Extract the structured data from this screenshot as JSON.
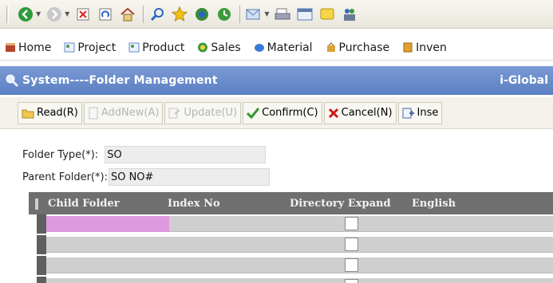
{
  "browser_toolbar": {
    "icons": [
      "back-icon",
      "forward-icon",
      "stop-icon",
      "refresh-icon",
      "home-icon",
      "search-icon",
      "favorites-icon",
      "media-icon",
      "history-icon",
      "mail-icon",
      "print-icon",
      "edit-icon",
      "discuss-icon",
      "messenger-icon"
    ]
  },
  "menu": {
    "items": [
      {
        "label": "Home"
      },
      {
        "label": "Project"
      },
      {
        "label": "Product"
      },
      {
        "label": "Sales"
      },
      {
        "label": "Material"
      },
      {
        "label": "Purchase"
      },
      {
        "label": "Inven"
      }
    ]
  },
  "title_bar": {
    "title": "System----Folder Management",
    "brand": "i-Global"
  },
  "actions": {
    "read": "Read(R)",
    "addnew": "AddNew(A)",
    "update": "Update(U)",
    "confirm": "Confirm(C)",
    "cancel": "Cancel(N)",
    "insert": "Inse"
  },
  "form": {
    "folder_type_label": "Folder Type(*):",
    "folder_type_value": "SO",
    "parent_folder_label": "Parent Folder(*):",
    "parent_folder_value": "SO NO#"
  },
  "grid": {
    "columns": [
      "Child Folder",
      "Index No",
      "Directory Expand",
      "English"
    ]
  },
  "colors": {
    "title_bar": "#5b7fc2",
    "grid_header": "#6f6f6f",
    "selected_cell": "#df9adf",
    "confirm_check": "#2e9a2e",
    "cancel_x": "#d01818"
  }
}
